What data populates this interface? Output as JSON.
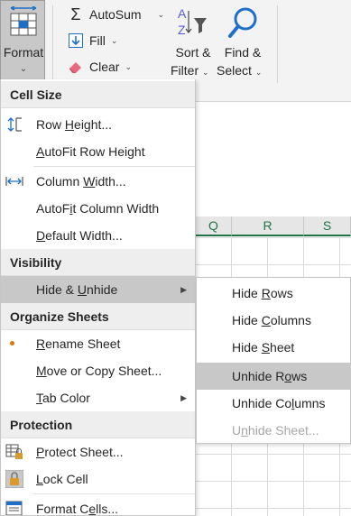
{
  "ribbon": {
    "format_label": "Format",
    "autosum_label": "AutoSum",
    "fill_label": "Fill",
    "clear_label": "Clear",
    "sort_line1": "Sort &",
    "sort_line2": "Filter",
    "find_line1": "Find &",
    "find_line2": "Select",
    "caret": "▾",
    "caret_small": "⌄",
    "sigma": "Σ"
  },
  "sheet": {
    "columns": [
      "Q",
      "R",
      "S"
    ]
  },
  "menu": {
    "sections": {
      "cell_size": "Cell Size",
      "visibility": "Visibility",
      "organize": "Organize Sheets",
      "protection": "Protection"
    },
    "items": {
      "row_height": {
        "pre": "Row ",
        "u": "H",
        "post": "eight..."
      },
      "autofit_row": {
        "pre": "",
        "u": "A",
        "post": "utoFit Row Height"
      },
      "column_width": {
        "pre": "Column ",
        "u": "W",
        "post": "idth..."
      },
      "autofit_col": {
        "pre": "AutoF",
        "u": "i",
        "post": "t Column Width"
      },
      "default_width": {
        "pre": "",
        "u": "D",
        "post": "efault Width..."
      },
      "hide_unhide": {
        "pre": "Hide & ",
        "u": "U",
        "post": "nhide"
      },
      "rename": {
        "pre": "",
        "u": "R",
        "post": "ename Sheet"
      },
      "move_copy": {
        "pre": "",
        "u": "M",
        "post": "ove or Copy Sheet..."
      },
      "tab_color": {
        "pre": "",
        "u": "T",
        "post": "ab Color"
      },
      "protect": {
        "pre": "",
        "u": "P",
        "post": "rotect Sheet..."
      },
      "lock": {
        "pre": "",
        "u": "L",
        "post": "ock Cell"
      },
      "format_cells": {
        "pre": "Format C",
        "u": "e",
        "post": "lls..."
      }
    },
    "arrow": "▶"
  },
  "submenu": {
    "items": {
      "hide_rows": {
        "pre": "Hide ",
        "u": "R",
        "post": "ows"
      },
      "hide_cols": {
        "pre": "Hide ",
        "u": "C",
        "post": "olumns"
      },
      "hide_sheet": {
        "pre": "Hide ",
        "u": "S",
        "post": "heet"
      },
      "unhide_rows": {
        "pre": "Unhide R",
        "u": "o",
        "post": "ws"
      },
      "unhide_cols": {
        "pre": "Unhide Co",
        "u": "l",
        "post": "umns"
      },
      "unhide_sheet": {
        "pre": "U",
        "u": "n",
        "post": "hide Sheet..."
      }
    }
  },
  "colors": {
    "accent_green": "#217346",
    "hover_gray": "#c8c8c8",
    "disabled_text": "#a6a6a6",
    "find_blue": "#1e6fc8",
    "sort_purple": "#5b5bd6"
  }
}
